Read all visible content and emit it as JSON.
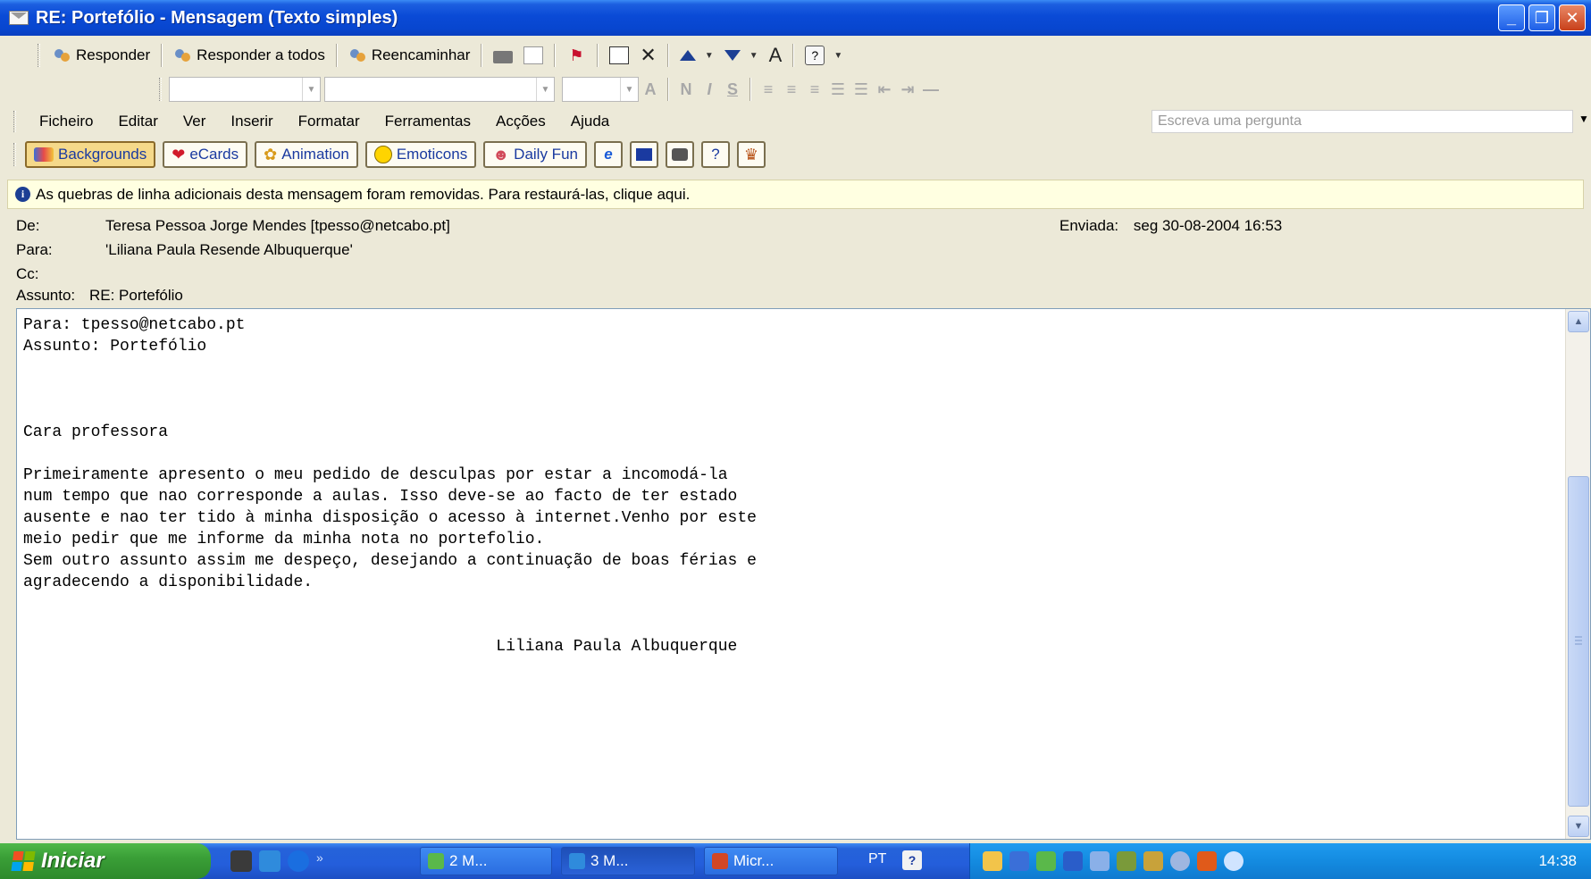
{
  "window": {
    "title": "RE: Portefólio - Mensagem (Texto simples)",
    "buttons": {
      "min": "_",
      "max": "❐",
      "close": "✕"
    }
  },
  "toolbar": {
    "reply": "Responder",
    "reply_all": "Responder a todos",
    "forward": "Reencaminhar",
    "help": "?"
  },
  "menu": {
    "items": [
      "Ficheiro",
      "Editar",
      "Ver",
      "Inserir",
      "Formatar",
      "Ferramentas",
      "Acções",
      "Ajuda"
    ],
    "ask_placeholder": "Escreva uma pergunta"
  },
  "addon_toolbar": {
    "backgrounds": "Backgrounds",
    "ecards": "eCards",
    "animation": "Animation",
    "emoticons": "Emoticons",
    "daily_fun": "Daily Fun",
    "q": "?"
  },
  "infobar": {
    "text": "As quebras de linha adicionais desta mensagem foram removidas. Para restaurá-las, clique aqui."
  },
  "header": {
    "from_label": "De:",
    "from": "Teresa Pessoa Jorge Mendes [tpesso@netcabo.pt]",
    "to_label": "Para:",
    "to": "'Liliana Paula Resende Albuquerque'",
    "cc_label": "Cc:",
    "cc": "",
    "subject_label": "Assunto:",
    "subject": "RE: Portefólio",
    "sent_label": "Enviada:",
    "sent": "seg 30-08-2004 16:53"
  },
  "body": {
    "text": "Para: tpesso@netcabo.pt\nAssunto: Portefólio\n\n\n\nCara professora\n\nPrimeiramente apresento o meu pedido de desculpas por estar a incomodá-la\nnum tempo que nao corresponde a aulas. Isso deve-se ao facto de ter estado\nausente e nao ter tido à minha disposição o acesso à internet.Venho por este\nmeio pedir que me informe da minha nota no portefolio.\nSem outro assunto assim me despeço, desejando a continuação de boas férias e\nagradecendo a disponibilidade.\n\n\n                                                 Liliana Paula Albuquerque"
  },
  "taskbar": {
    "start": "Iniciar",
    "tasks": [
      "2 M...",
      "3 M...",
      "Micr..."
    ],
    "lang": "PT",
    "clock": "14:38"
  }
}
